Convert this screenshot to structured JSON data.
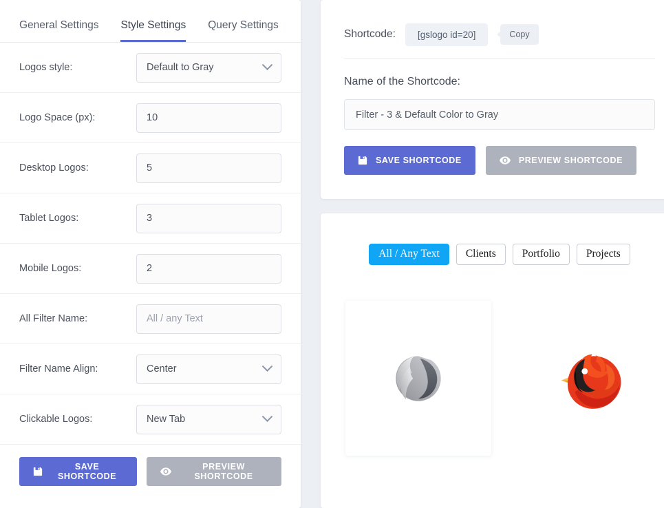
{
  "settings_panel": {
    "tabs": [
      {
        "label": "General Settings",
        "active": false
      },
      {
        "label": "Style Settings",
        "active": true
      },
      {
        "label": "Query Settings",
        "active": false
      }
    ],
    "fields": [
      {
        "label": "Logos style:",
        "type": "select",
        "value": "Default to Gray"
      },
      {
        "label": "Logo Space (px):",
        "type": "input",
        "value": "10"
      },
      {
        "label": "Desktop Logos:",
        "type": "input",
        "value": "5"
      },
      {
        "label": "Tablet Logos:",
        "type": "input",
        "value": "3"
      },
      {
        "label": "Mobile Logos:",
        "type": "input",
        "value": "2"
      },
      {
        "label": "All Filter Name:",
        "type": "input",
        "value": "",
        "placeholder": "All / any Text"
      },
      {
        "label": "Filter Name Align:",
        "type": "select",
        "value": "Center"
      },
      {
        "label": "Clickable Logos:",
        "type": "select",
        "value": "New Tab"
      }
    ],
    "save_label": "SAVE SHORTCODE",
    "preview_label": "PREVIEW SHORTCODE"
  },
  "shortcode_panel": {
    "shortcode_label": "Shortcode:",
    "shortcode_value": "[gslogo id=20]",
    "copy_label": "Copy",
    "name_label": "Name of the Shortcode:",
    "name_value": "Filter - 3 & Default Color to Gray",
    "name_placeholder": "Name of the Shortcode",
    "save_label": "SAVE SHORTCODE",
    "preview_label": "PREVIEW SHORTCODE"
  },
  "preview_panel": {
    "filters": [
      {
        "label": "All / Any Text",
        "active": true
      },
      {
        "label": "Clients",
        "active": false
      },
      {
        "label": "Portfolio",
        "active": false
      },
      {
        "label": "Projects",
        "active": false
      }
    ],
    "logos": [
      {
        "name": "bird-logo-grayscale",
        "style": "gray",
        "carded": true
      },
      {
        "name": "bird-logo-color",
        "style": "color",
        "carded": false
      }
    ]
  },
  "colors": {
    "accent_indigo": "#5c6bd4",
    "muted_gray": "#aeb2bd",
    "filter_active_blue": "#10a5f5",
    "page_background": "#eceff4"
  },
  "icons": {
    "save": "floppy-disk-icon",
    "preview": "eye-icon",
    "dropdown": "chevron-down-icon"
  }
}
